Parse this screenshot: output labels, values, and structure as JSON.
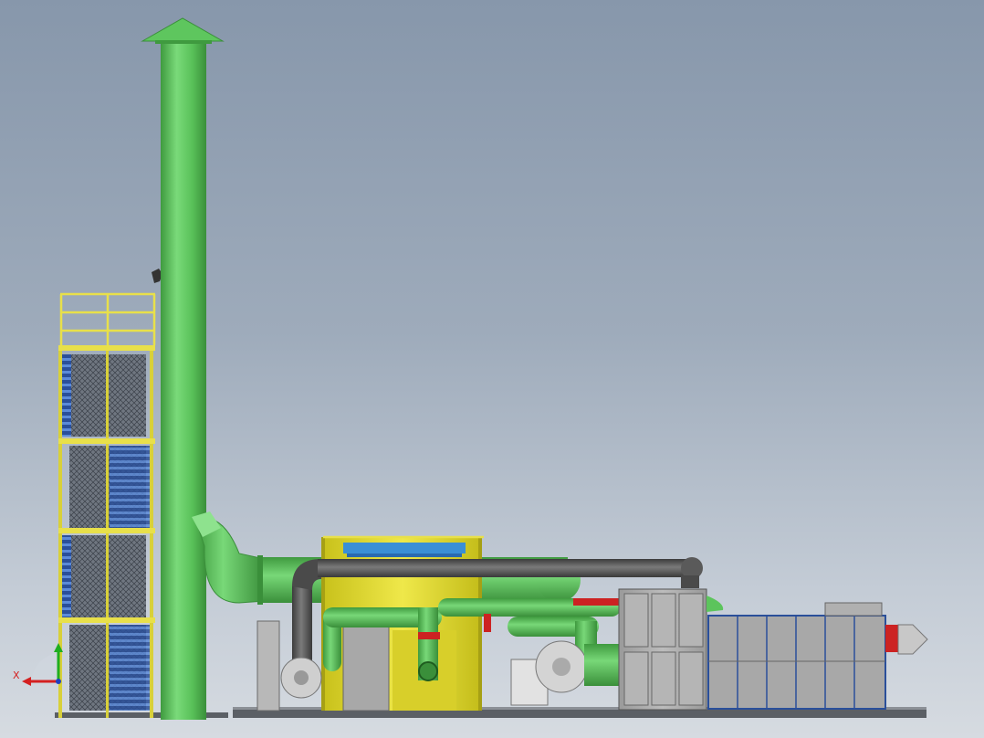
{
  "view": {
    "background_top": "#8797ab",
    "background_bottom": "#d6dbe1"
  },
  "colors": {
    "pipe_green": "#5cc45c",
    "pipe_green_dark": "#3f9a3f",
    "pipe_grey": "#5a5a5a",
    "structure_yellow": "#e8e04a",
    "grating_blue": "#3a6fc6",
    "housing_grey": "#a9a9a9",
    "damper_red": "#cc2222"
  },
  "triad": {
    "x_label": "X",
    "x_color": "#d42020",
    "y_color": "#1fae1f",
    "z_color": "#2040c0"
  }
}
